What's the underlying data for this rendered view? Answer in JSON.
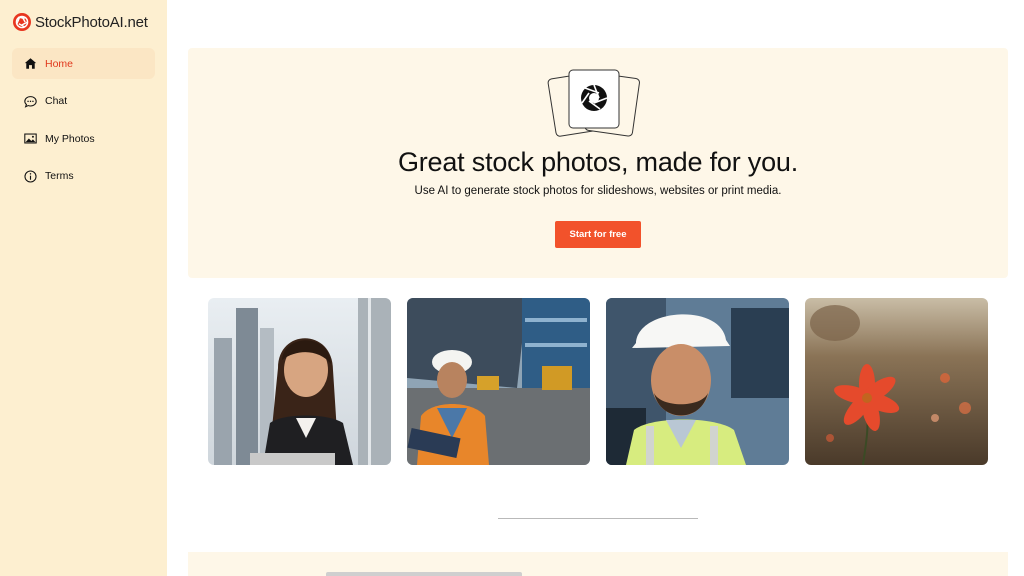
{
  "brand": {
    "name": "StockPhotoAI.net",
    "logo_icon": "aperture-icon",
    "accent": "#f2522b"
  },
  "sidebar": {
    "items": [
      {
        "label": "Home",
        "icon": "home-icon",
        "active": true
      },
      {
        "label": "Chat",
        "icon": "chat-bubble-icon",
        "active": false
      },
      {
        "label": "My Photos",
        "icon": "image-icon",
        "active": false
      },
      {
        "label": "Terms",
        "icon": "info-icon",
        "active": false
      }
    ]
  },
  "hero": {
    "title": "Great stock photos, made for you.",
    "subtitle": "Use AI to generate stock photos for slideshows, websites or print media.",
    "cta_label": "Start for free",
    "illustration": "stacked-photo-cards-aperture-icon"
  },
  "gallery": {
    "photos": [
      {
        "subject": "woman-with-tablet-city"
      },
      {
        "subject": "worker-hardhat-shipyard"
      },
      {
        "subject": "smiling-engineer-hardhat"
      },
      {
        "subject": "red-flower-field"
      }
    ]
  },
  "colors": {
    "sidebar_bg": "#fdefd0",
    "hero_bg": "#fef7e8",
    "active_nav_text": "#e0381c",
    "cta_bg": "#f2522b"
  }
}
